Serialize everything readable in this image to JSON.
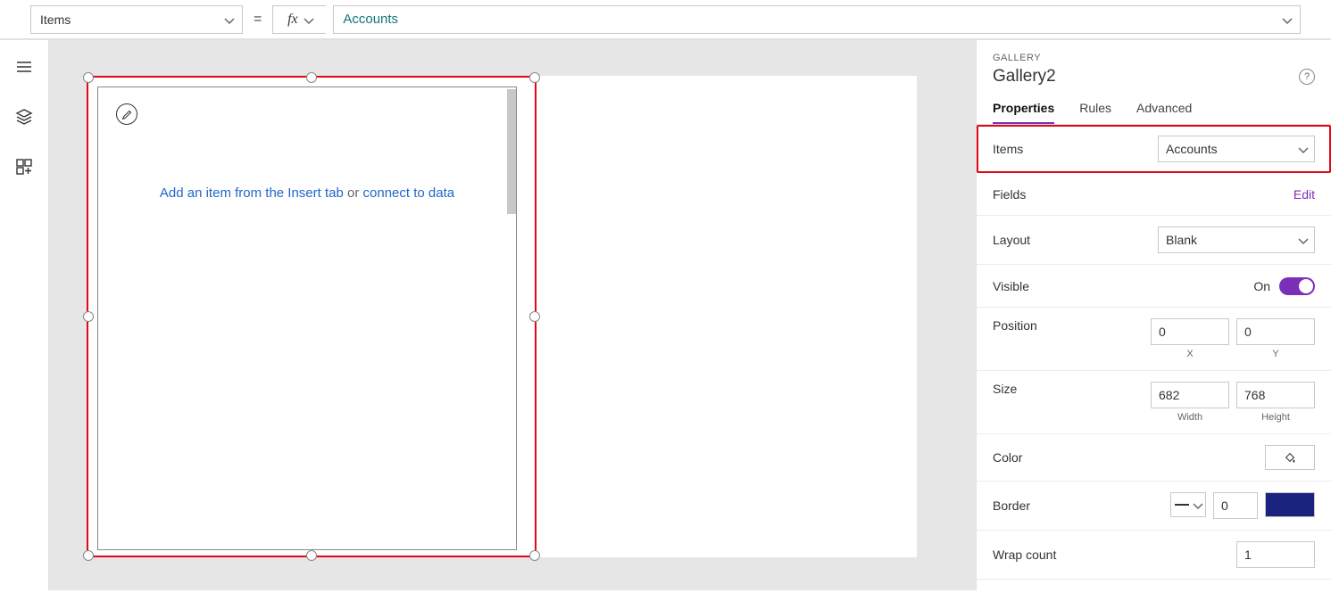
{
  "formulaBar": {
    "property": "Items",
    "formula": "Accounts"
  },
  "canvas": {
    "placeholder_link1": "Add an item from the Insert tab",
    "placeholder_or": " or ",
    "placeholder_link2": "connect to data"
  },
  "rightPane": {
    "type": "GALLERY",
    "name": "Gallery2",
    "tabs": {
      "properties": "Properties",
      "rules": "Rules",
      "advanced": "Advanced"
    },
    "props": {
      "items_label": "Items",
      "items_value": "Accounts",
      "fields_label": "Fields",
      "fields_action": "Edit",
      "layout_label": "Layout",
      "layout_value": "Blank",
      "visible_label": "Visible",
      "visible_value": "On",
      "position_label": "Position",
      "pos_x": "0",
      "pos_y": "0",
      "pos_x_l": "X",
      "pos_y_l": "Y",
      "size_label": "Size",
      "size_w": "682",
      "size_h": "768",
      "size_w_l": "Width",
      "size_h_l": "Height",
      "color_label": "Color",
      "border_label": "Border",
      "border_width": "0",
      "wrap_label": "Wrap count",
      "wrap_value": "1"
    }
  }
}
